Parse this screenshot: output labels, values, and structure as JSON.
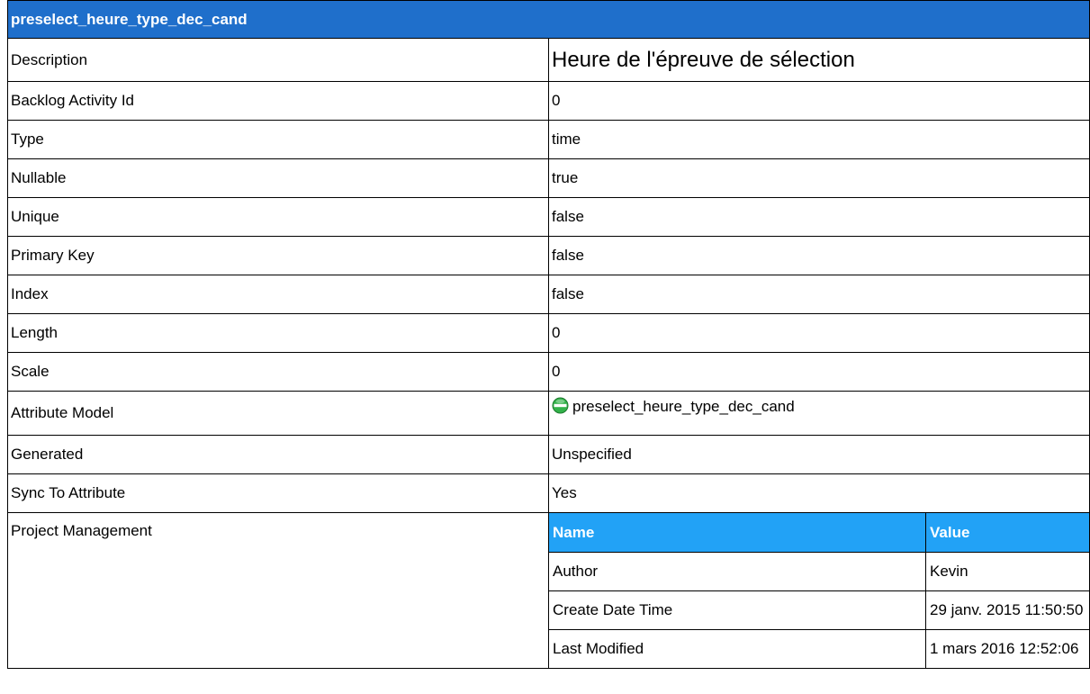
{
  "title": "preselect_heure_type_dec_cand",
  "colors": {
    "title_bg": "#1f6fcb",
    "nested_header_bg": "#22a2f6",
    "icon_fill": "#33b24a",
    "icon_bar": "#ffffff"
  },
  "rows": {
    "description": {
      "label": "Description",
      "value": "Heure de l'épreuve de sélection"
    },
    "backlog_activity_id": {
      "label": "Backlog Activity Id",
      "value": "0"
    },
    "type": {
      "label": "Type",
      "value": "time"
    },
    "nullable": {
      "label": "Nullable",
      "value": "true"
    },
    "unique": {
      "label": "Unique",
      "value": "false"
    },
    "primary_key": {
      "label": "Primary Key",
      "value": "false"
    },
    "index": {
      "label": "Index",
      "value": "false"
    },
    "length": {
      "label": "Length",
      "value": "0"
    },
    "scale": {
      "label": "Scale",
      "value": "0"
    },
    "attribute_model": {
      "label": "Attribute Model",
      "value": "preselect_heure_type_dec_cand",
      "icon": "attribute-model-icon"
    },
    "generated": {
      "label": "Generated",
      "value": "Unspecified"
    },
    "sync_to_attribute": {
      "label": "Sync To Attribute",
      "value": "Yes"
    }
  },
  "project_management": {
    "label": "Project Management",
    "headers": {
      "name": "Name",
      "value": "Value"
    },
    "items": [
      {
        "name": "Author",
        "value": "Kevin"
      },
      {
        "name": "Create Date Time",
        "value": "29 janv. 2015 11:50:50"
      },
      {
        "name": "Last Modified",
        "value": "1 mars 2016 12:52:06"
      }
    ]
  }
}
